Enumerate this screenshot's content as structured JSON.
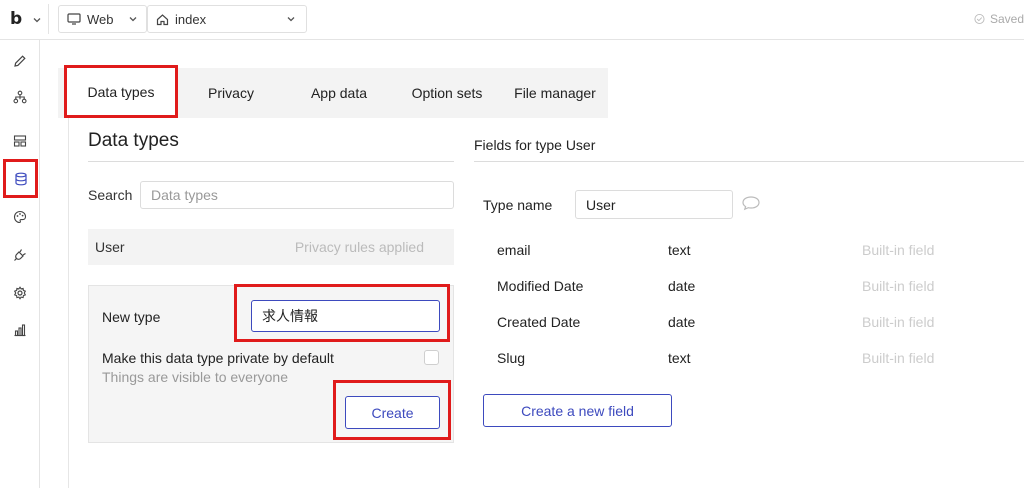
{
  "topbar": {
    "logo": "b",
    "platform_label": "Web",
    "page_label": "index",
    "saved_label": "Saved"
  },
  "sidebar": {
    "items": [
      {
        "icon": "pencil-icon"
      },
      {
        "icon": "sitemap-icon"
      },
      {
        "icon": "layout-icon"
      },
      {
        "icon": "database-icon",
        "active": true
      },
      {
        "icon": "palette-icon"
      },
      {
        "icon": "plug-icon"
      },
      {
        "icon": "gear-icon"
      },
      {
        "icon": "bar-chart-icon"
      }
    ]
  },
  "tabs": [
    {
      "label": "Data types",
      "active": true
    },
    {
      "label": "Privacy"
    },
    {
      "label": "App data"
    },
    {
      "label": "Option sets"
    },
    {
      "label": "File manager"
    }
  ],
  "data_types": {
    "title": "Data types",
    "search_label": "Search",
    "search_placeholder": "Data types",
    "types": [
      {
        "name": "User",
        "privacy": "Privacy rules applied"
      }
    ],
    "new_type": {
      "label": "New type",
      "value": "求人情報",
      "private_label": "Make this data type private by default",
      "private_sub": "Things are visible to everyone",
      "private_checked": false,
      "create_label": "Create"
    }
  },
  "fields_panel": {
    "title": "Fields for type User",
    "type_name_label": "Type name",
    "type_name_value": "User",
    "fields": [
      {
        "name": "email",
        "type": "text",
        "note": "Built-in field"
      },
      {
        "name": "Modified Date",
        "type": "date",
        "note": "Built-in field"
      },
      {
        "name": "Created Date",
        "type": "date",
        "note": "Built-in field"
      },
      {
        "name": "Slug",
        "type": "text",
        "note": "Built-in field"
      }
    ],
    "new_field_label": "Create a new field"
  },
  "colors": {
    "accent": "#3d4abe",
    "highlight": "#e01b1b"
  }
}
